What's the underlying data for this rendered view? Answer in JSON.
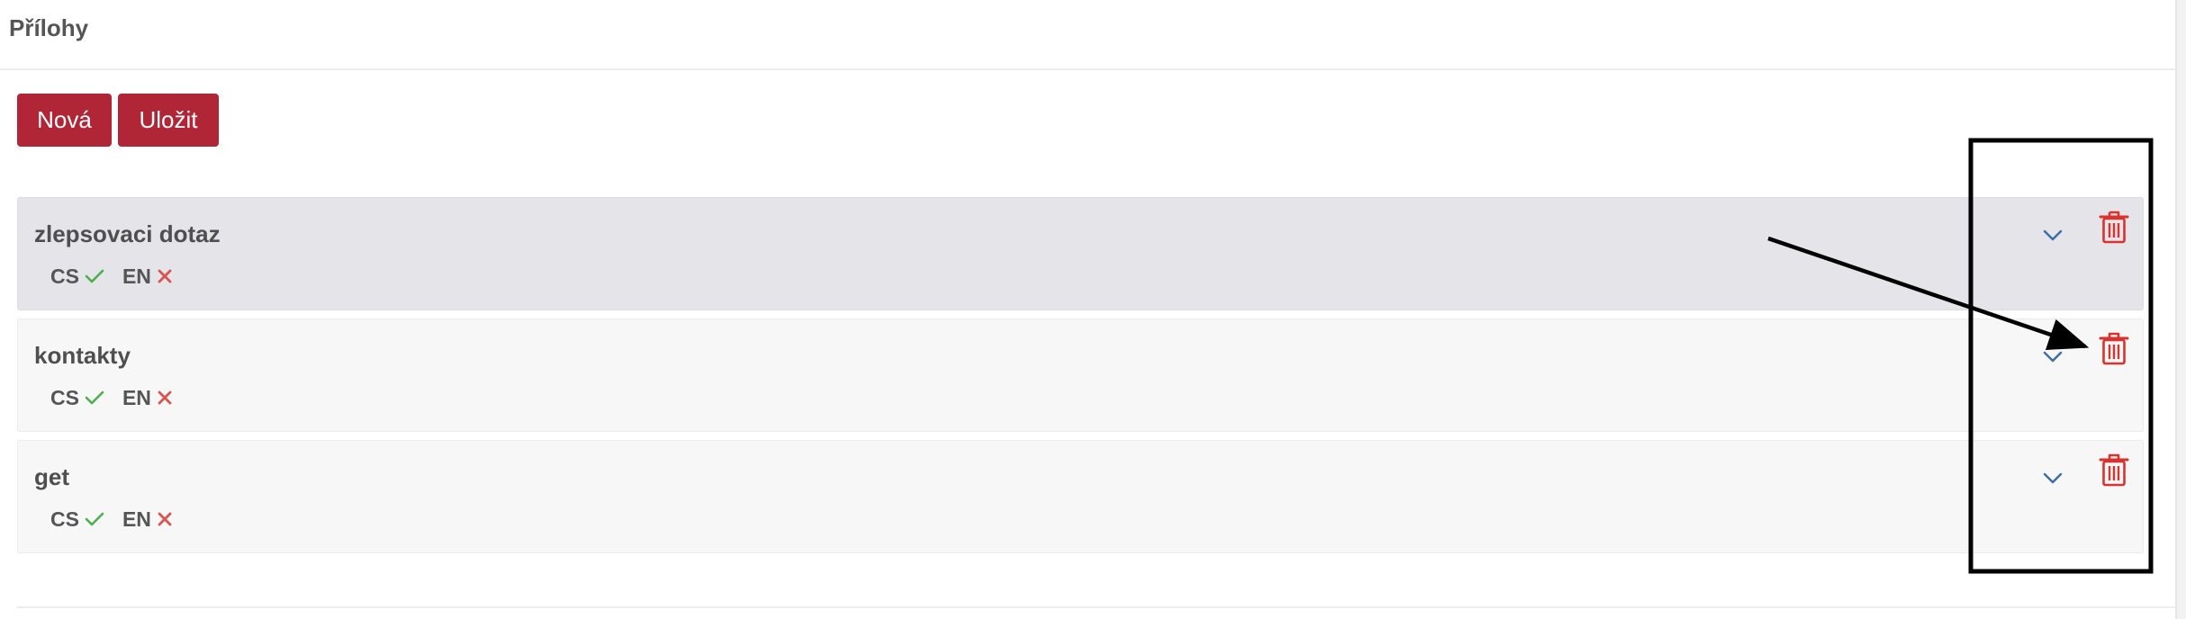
{
  "panel": {
    "title": "Přílohy"
  },
  "toolbar": {
    "new_label": "Nová",
    "save_label": "Uložit"
  },
  "colors": {
    "primary": "#b02636",
    "active_row": "#e4e4e9",
    "row": "#f7f7f7",
    "check": "#4cae4c",
    "cross": "#d9534f",
    "chevron": "#3a6ea5",
    "trash": "#d9322f"
  },
  "items": [
    {
      "name": "zlepsovaci dotaz",
      "active": true,
      "langs": [
        {
          "code": "CS",
          "status_icon": "check-icon"
        },
        {
          "code": "EN",
          "status_icon": "cross-icon"
        }
      ]
    },
    {
      "name": "kontakty",
      "active": false,
      "langs": [
        {
          "code": "CS",
          "status_icon": "check-icon"
        },
        {
          "code": "EN",
          "status_icon": "cross-icon"
        }
      ]
    },
    {
      "name": "get",
      "active": false,
      "langs": [
        {
          "code": "CS",
          "status_icon": "check-icon"
        },
        {
          "code": "EN",
          "status_icon": "cross-icon"
        }
      ]
    }
  ],
  "icons": {
    "expand": "chevron-down-icon",
    "delete": "trash-icon"
  }
}
